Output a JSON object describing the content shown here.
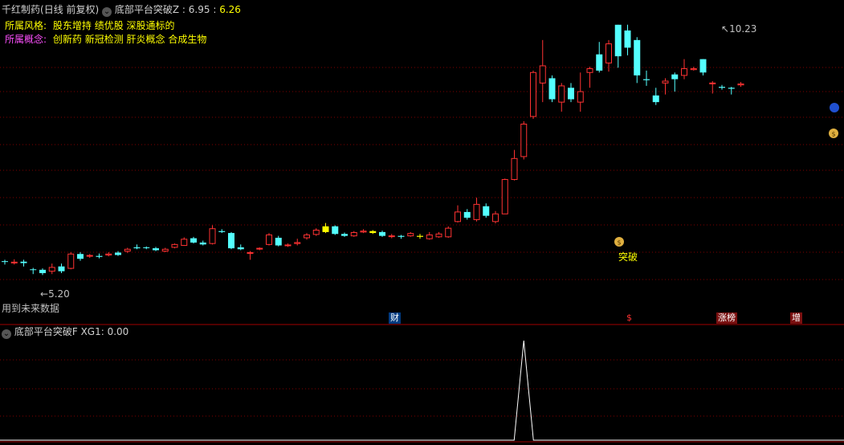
{
  "header": {
    "stock_name": "千红制药",
    "period": "(日线 前复权)",
    "indicator_name": "底部平台突破Z",
    "value_sep": ":",
    "value1": "6.95",
    "value2": "6.26",
    "style_label": "所属风格:",
    "style_value": "股东增持 绩优股 深股通标的",
    "concept_label": "所属概念:",
    "concept_value": "创新药 新冠检测 肝炎概念 合成生物"
  },
  "annotations": {
    "high_price": "10.23",
    "low_price": "5.20",
    "breakout": "突破",
    "future_data": "用到未来数据"
  },
  "markers": {
    "m1": "财",
    "m2": "$",
    "m3": "涨榜",
    "m4": "增"
  },
  "sub_panel": {
    "indicator_name": "底部平台突破F",
    "series": "XG1:",
    "value": "0.00"
  },
  "colors": {
    "up": "#ff3232",
    "down": "#54ffff",
    "signal": "#ffff00",
    "grid": "#800000",
    "border": "#a00000"
  },
  "chart_data": {
    "type": "candlestick",
    "price_range": [
      4.9,
      10.5
    ],
    "signal_bars": [
      34,
      39,
      44
    ],
    "candles": [
      [
        5.57,
        5.56,
        5.6,
        5.5
      ],
      [
        5.55,
        5.55,
        5.61,
        5.5
      ],
      [
        5.56,
        5.53,
        5.6,
        5.46
      ],
      [
        5.4,
        5.39,
        5.43,
        5.3
      ],
      [
        5.39,
        5.32,
        5.42,
        5.28
      ],
      [
        5.36,
        5.44,
        5.52,
        5.3
      ],
      [
        5.46,
        5.36,
        5.52,
        5.32
      ],
      [
        5.42,
        5.72,
        5.76,
        5.4
      ],
      [
        5.72,
        5.62,
        5.76,
        5.58
      ],
      [
        5.68,
        5.69,
        5.72,
        5.64
      ],
      [
        5.68,
        5.66,
        5.73,
        5.63
      ],
      [
        5.7,
        5.72,
        5.76,
        5.67
      ],
      [
        5.75,
        5.7,
        5.78,
        5.68
      ],
      [
        5.78,
        5.82,
        5.85,
        5.74
      ],
      [
        5.86,
        5.84,
        5.92,
        5.82
      ],
      [
        5.86,
        5.85,
        5.88,
        5.82
      ],
      [
        5.84,
        5.8,
        5.87,
        5.78
      ],
      [
        5.78,
        5.82,
        5.85,
        5.76
      ],
      [
        5.86,
        5.92,
        5.94,
        5.84
      ],
      [
        5.9,
        6.03,
        6.07,
        5.89
      ],
      [
        6.05,
        5.96,
        6.08,
        5.94
      ],
      [
        5.96,
        5.92,
        6.0,
        5.9
      ],
      [
        5.94,
        6.25,
        6.32,
        5.92
      ],
      [
        6.2,
        6.18,
        6.24,
        6.16
      ],
      [
        6.16,
        5.84,
        6.18,
        5.82
      ],
      [
        5.86,
        5.82,
        5.92,
        5.8
      ],
      [
        5.74,
        5.75,
        5.78,
        5.6
      ],
      [
        5.84,
        5.84,
        5.86,
        5.8
      ],
      [
        5.92,
        6.12,
        6.16,
        5.9
      ],
      [
        6.06,
        5.9,
        6.1,
        5.88
      ],
      [
        5.91,
        5.91,
        5.94,
        5.87
      ],
      [
        5.94,
        5.96,
        6.04,
        5.9
      ],
      [
        6.06,
        6.12,
        6.16,
        6.02
      ],
      [
        6.13,
        6.22,
        6.26,
        6.1
      ],
      [
        6.18,
        6.3,
        6.37,
        6.16
      ],
      [
        6.3,
        6.14,
        6.32,
        6.12
      ],
      [
        6.14,
        6.1,
        6.17,
        6.08
      ],
      [
        6.1,
        6.17,
        6.2,
        6.08
      ],
      [
        6.18,
        6.2,
        6.24,
        6.16
      ],
      [
        6.2,
        6.16,
        6.22,
        6.14
      ],
      [
        6.18,
        6.1,
        6.21,
        6.08
      ],
      [
        6.1,
        6.1,
        6.14,
        6.05
      ],
      [
        6.1,
        6.08,
        6.12,
        6.04
      ],
      [
        6.1,
        6.15,
        6.18,
        6.08
      ],
      [
        6.1,
        6.08,
        6.14,
        6.04
      ],
      [
        6.04,
        6.12,
        6.18,
        6.02
      ],
      [
        6.08,
        6.14,
        6.18,
        6.06
      ],
      [
        6.08,
        6.26,
        6.3,
        6.06
      ],
      [
        6.4,
        6.6,
        6.74,
        6.38
      ],
      [
        6.6,
        6.48,
        6.66,
        6.44
      ],
      [
        6.44,
        6.76,
        6.9,
        6.4
      ],
      [
        6.72,
        6.52,
        6.78,
        6.48
      ],
      [
        6.4,
        6.56,
        6.62,
        6.36
      ],
      [
        6.56,
        7.28,
        7.3,
        6.56
      ],
      [
        7.28,
        7.72,
        7.9,
        7.26
      ],
      [
        7.76,
        8.44,
        8.5,
        7.7
      ],
      [
        8.6,
        9.52,
        9.56,
        8.55
      ],
      [
        9.3,
        9.66,
        10.2,
        8.9
      ],
      [
        9.4,
        8.96,
        9.46,
        8.9
      ],
      [
        8.9,
        9.24,
        9.3,
        8.7
      ],
      [
        9.2,
        8.96,
        9.3,
        8.9
      ],
      [
        8.9,
        9.12,
        9.52,
        8.7
      ],
      [
        9.52,
        9.6,
        9.64,
        9.2
      ],
      [
        9.9,
        9.56,
        10.16,
        9.52
      ],
      [
        9.72,
        10.12,
        10.2,
        9.54
      ],
      [
        10.52,
        9.86,
        10.52,
        9.62
      ],
      [
        10.4,
        10.04,
        10.52,
        9.88
      ],
      [
        10.2,
        9.46,
        10.26,
        9.3
      ],
      [
        9.38,
        9.36,
        9.56,
        9.24
      ],
      [
        9.04,
        8.9,
        9.2,
        8.84
      ],
      [
        9.3,
        9.34,
        9.4,
        9.06
      ],
      [
        9.48,
        9.38,
        9.52,
        9.12
      ],
      [
        9.46,
        9.6,
        9.8,
        9.38
      ],
      [
        9.58,
        9.6,
        9.64,
        9.56
      ],
      [
        9.8,
        9.52,
        9.8,
        9.46
      ],
      [
        9.3,
        9.3,
        9.34,
        9.08
      ],
      [
        9.22,
        9.2,
        9.26,
        9.16
      ],
      [
        9.2,
        9.18,
        9.22,
        9.06
      ],
      [
        9.26,
        9.28,
        9.32,
        9.22
      ]
    ],
    "signal_series": {
      "name": "XG1",
      "peak_bar": 55
    }
  }
}
